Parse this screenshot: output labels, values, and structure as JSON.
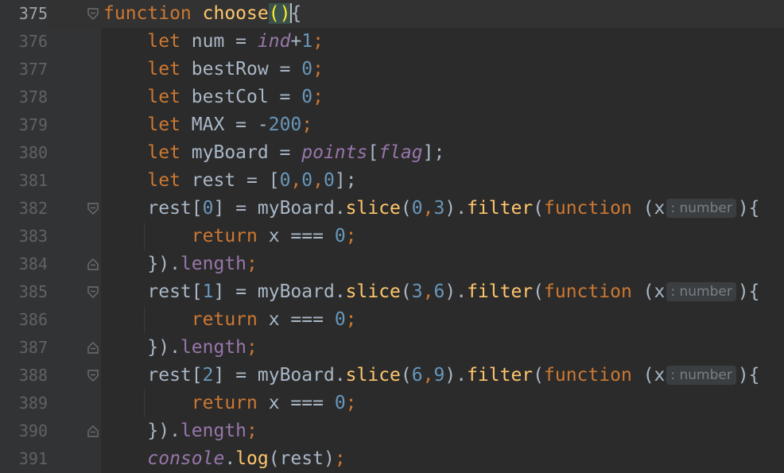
{
  "editor": {
    "lines": [
      {
        "num": "375",
        "hl": true
      },
      {
        "num": "376"
      },
      {
        "num": "377"
      },
      {
        "num": "378"
      },
      {
        "num": "379"
      },
      {
        "num": "380"
      },
      {
        "num": "381"
      },
      {
        "num": "382"
      },
      {
        "num": "383"
      },
      {
        "num": "384"
      },
      {
        "num": "385"
      },
      {
        "num": "386"
      },
      {
        "num": "387"
      },
      {
        "num": "388"
      },
      {
        "num": "389"
      },
      {
        "num": "390"
      },
      {
        "num": "391"
      }
    ],
    "tokens": {
      "l375": [
        "function",
        " ",
        "choose",
        "(",
        ")",
        "{"
      ],
      "l376": [
        "let",
        " num = ",
        "ind",
        "+",
        "1",
        ";"
      ],
      "l377": [
        "let",
        " bestRow = ",
        "0",
        ";"
      ],
      "l378": [
        "let",
        " bestCol = ",
        "0",
        ";"
      ],
      "l379": [
        "let",
        " MAX = -",
        "200",
        ";"
      ],
      "l380": [
        "let",
        " myBoard = ",
        "points",
        "[",
        "flag",
        "];"
      ],
      "l381": [
        "let",
        " rest = [",
        "0",
        ",",
        "0",
        ",",
        "0",
        "];"
      ],
      "l382": [
        "rest[",
        "0",
        "] = myBoard.",
        "slice",
        "(",
        "0",
        ",",
        "3",
        ").",
        "filter",
        "(",
        "function",
        " (x",
        ": number",
        "){"
      ],
      "l383": [
        "return",
        " x === ",
        "0",
        ";"
      ],
      "l384": [
        "}).",
        "length",
        ";"
      ],
      "l385": [
        "rest[",
        "1",
        "] = myBoard.",
        "slice",
        "(",
        "3",
        ",",
        "6",
        ").",
        "filter",
        "(",
        "function",
        " (x",
        ": number",
        "){"
      ],
      "l386": [
        "return",
        " x === ",
        "0",
        ";"
      ],
      "l387": [
        "}).",
        "length",
        ";"
      ],
      "l388": [
        "rest[",
        "2",
        "] = myBoard.",
        "slice",
        "(",
        "6",
        ",",
        "9",
        ").",
        "filter",
        "(",
        "function",
        " (x",
        ": number",
        "){"
      ],
      "l389": [
        "return",
        " x === ",
        "0",
        ";"
      ],
      "l390": [
        "}).",
        "length",
        ";"
      ],
      "l391": [
        "console",
        ".",
        "log",
        "(rest)",
        ";"
      ]
    }
  },
  "colors": {
    "background": "#2b2b2b",
    "gutter": "#313335",
    "keyword": "#cc7832",
    "function_name": "#ffc66d",
    "number": "#6897bb",
    "identifier": "#a9b7c6",
    "global": "#9876aa"
  },
  "icons": {
    "fold_open": "fold-open-icon",
    "fold_close": "fold-close-icon"
  }
}
